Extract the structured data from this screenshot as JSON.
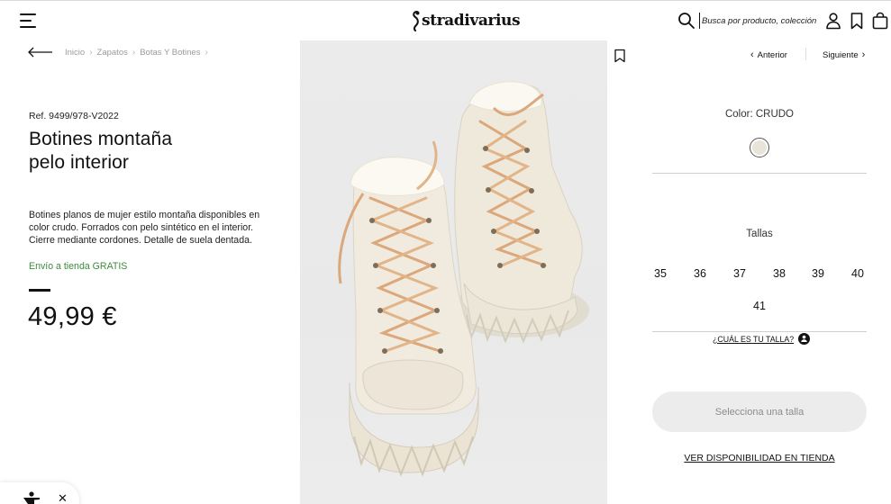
{
  "header": {
    "brand": "stradivarius",
    "search_placeholder": "Busca por producto, colección...",
    "icons": [
      "menu-icon",
      "search-icon",
      "user-icon",
      "bookmark-icon",
      "bag-icon"
    ]
  },
  "breadcrumb": [
    "Inicio",
    "Zapatos",
    "Botas Y Botines"
  ],
  "product": {
    "ref": "Ref. 9499/978-V2022",
    "title_line1": "Botines montaña",
    "title_line2": "pelo interior",
    "description": "Botines planos de mujer estilo montaña disponibles en color crudo. Forrados con pelo sintético en el interior. Cierre mediante cordones. Detalle de suela dentada.",
    "shipping": "Envío a tienda GRATIS",
    "price": "49,99 €"
  },
  "navigation": {
    "prev": "Anterior",
    "next": "Siguiente"
  },
  "color": {
    "label": "Color: CRUDO",
    "swatch_hex": "#e9e4da"
  },
  "sizes": {
    "label": "Tallas",
    "row1": [
      "35",
      "36",
      "37",
      "38",
      "39",
      "40"
    ],
    "row2": [
      "41"
    ]
  },
  "size_guide": "¿CUÁL ES TU TALLA?",
  "cta": "Selecciona una talla",
  "store_link": "VER DISPONIBILIDAD EN TIENDA",
  "colors": {
    "accent_green": "#3d8a3d",
    "cta_bg": "#ececec"
  }
}
